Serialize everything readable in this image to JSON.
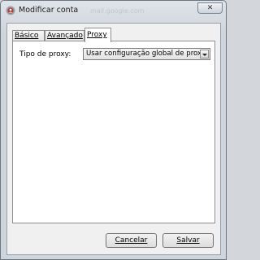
{
  "window": {
    "title": "Modificar conta",
    "ghost_title": "mail.google.com",
    "close_glyph": "✕"
  },
  "tabs": [
    {
      "label": "Básico"
    },
    {
      "label": "Avançado"
    },
    {
      "label": "Proxy",
      "active": true
    }
  ],
  "proxy": {
    "label": "Tipo de proxy:",
    "selected": "Usar configuração global de proxy"
  },
  "buttons": {
    "cancel": "Cancelar",
    "save": "Salvar"
  },
  "colors": {
    "accent_icon": "#c0392b",
    "window_bg": "#cfd5dc",
    "panel_bg": "#ffffff"
  },
  "icons": {
    "app": "account-icon",
    "close": "close-icon",
    "dropdown": "chevron-down-icon"
  }
}
